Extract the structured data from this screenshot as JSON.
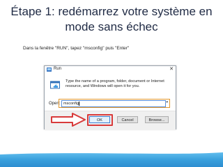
{
  "slide": {
    "title": "Étape 1: redémarrez votre système en mode sans échec",
    "subtitle": "Dans la fenêtre \"RUN\", tapez \"msconfig\" puis \"Enter\""
  },
  "run_dialog": {
    "title": "Run",
    "close_glyph": "✕",
    "description": "Type the name of a program, folder, document or Internet resource, and Windows will open it for you.",
    "open_label": "Open:",
    "open_value": "msconfig",
    "buttons": {
      "ok": "OK",
      "cancel": "Cancel",
      "browse": "Browse..."
    }
  },
  "colors": {
    "highlight_input": "#e3962a",
    "highlight_ok": "#d83a3a",
    "arrow": "#d83a3a",
    "bar": "#3aa0dd"
  },
  "icons": [
    "run-icon",
    "run-app-icon",
    "close-icon",
    "dropdown-arrow-icon",
    "red-arrow-icon"
  ]
}
